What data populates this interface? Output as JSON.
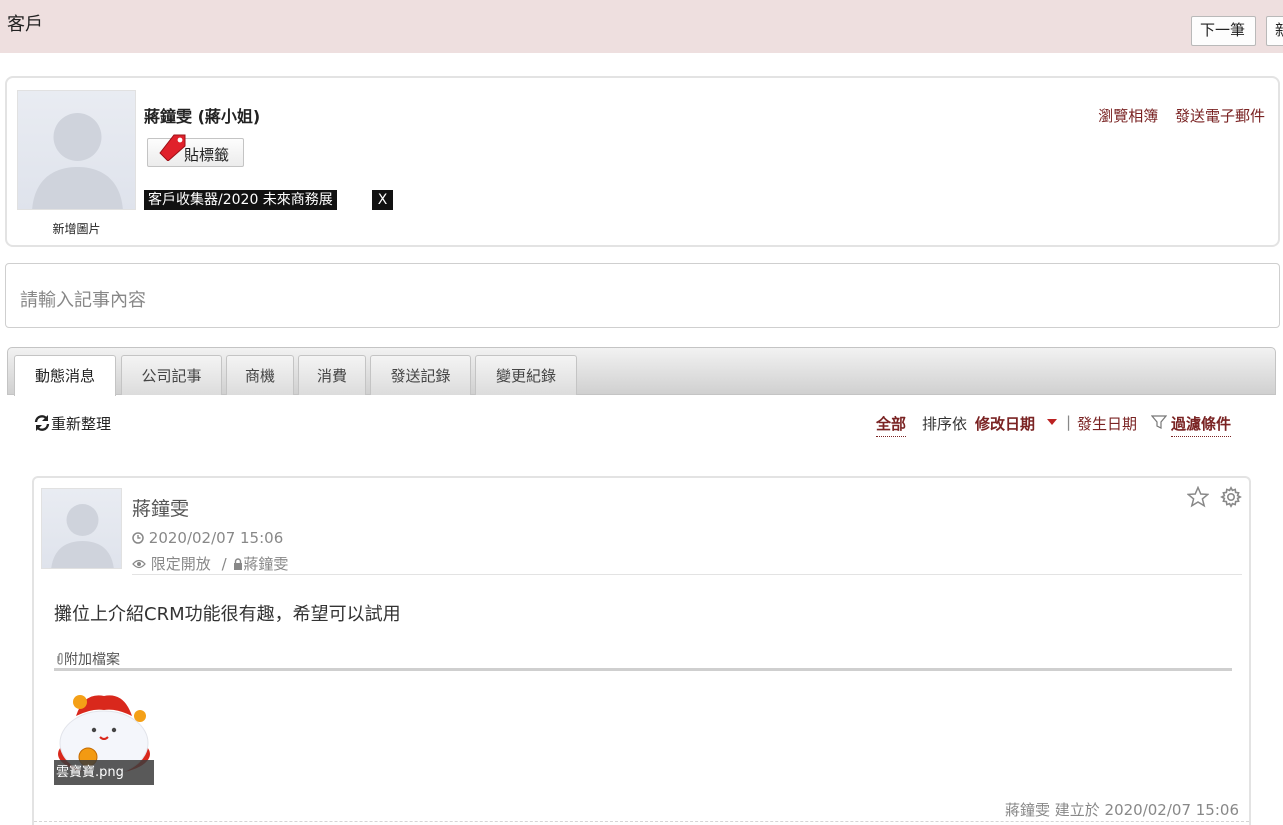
{
  "header": {
    "title": "客戶",
    "next_label": "下一筆",
    "new_label": "新"
  },
  "profile": {
    "name": "蔣鐘雯 (蔣小姐)",
    "add_picture": "新增圖片",
    "tag_button": "貼標籤",
    "tag": "客戶收集器/2020 未來商務展",
    "tag_remove": "X",
    "links": [
      "瀏覽相簿",
      "發送電子郵件"
    ]
  },
  "note": {
    "placeholder": "請輸入記事內容"
  },
  "tabs": [
    {
      "label": "動態消息",
      "active": true
    },
    {
      "label": "公司記事",
      "active": false
    },
    {
      "label": "商機",
      "active": false
    },
    {
      "label": "消費",
      "active": false
    },
    {
      "label": "發送記錄",
      "active": false
    },
    {
      "label": "變更紀錄",
      "active": false
    }
  ],
  "toolbar": {
    "refresh": "重新整理",
    "all": "全部",
    "sort_by": "排序依",
    "modified_date": "修改日期",
    "separator": "|",
    "occur_date": "發生日期",
    "filter": "過濾條件"
  },
  "post": {
    "author": "蔣鐘雯",
    "time": "2020/02/07 15:06",
    "visibility": "限定開放",
    "visibility_sep": "/",
    "visibility_owner": "蔣鐘雯",
    "body": "攤位上介紹CRM功能很有趣，希望可以試用",
    "attachments_label": "附加檔案",
    "attachment_name": "雲寶寶.png",
    "footer": "蔣鐘雯 建立於 2020/02/07 15:06"
  },
  "colors": {
    "topbar_bg": "#eedfdf",
    "link_red": "#7a2323",
    "caret_red": "#bb2222"
  }
}
